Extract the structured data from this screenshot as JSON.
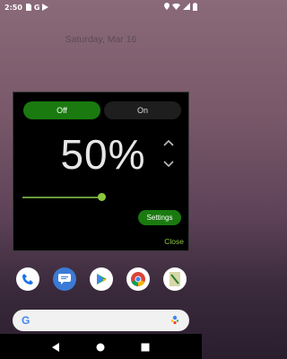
{
  "status_bar": {
    "time": "2:50",
    "icons": [
      "sim-card-icon",
      "google-g-icon",
      "play-store-icon"
    ],
    "right_icons": [
      "location-icon",
      "wifi-icon",
      "signal-icon",
      "battery-icon"
    ]
  },
  "home": {
    "date": "Saturday, Mar 16"
  },
  "dialog": {
    "off_label": "Off",
    "on_label": "On",
    "percent_text": "50%",
    "slider_value": 0.5,
    "settings_label": "Settings",
    "close_label": "Close"
  },
  "dock": {
    "apps": [
      "phone-icon",
      "messages-icon",
      "play-store-icon",
      "chrome-icon",
      "notes-icon"
    ]
  },
  "colors": {
    "accent_green": "#1a7a10",
    "light_green": "#8cc63f",
    "dialog_bg": "#000000"
  }
}
